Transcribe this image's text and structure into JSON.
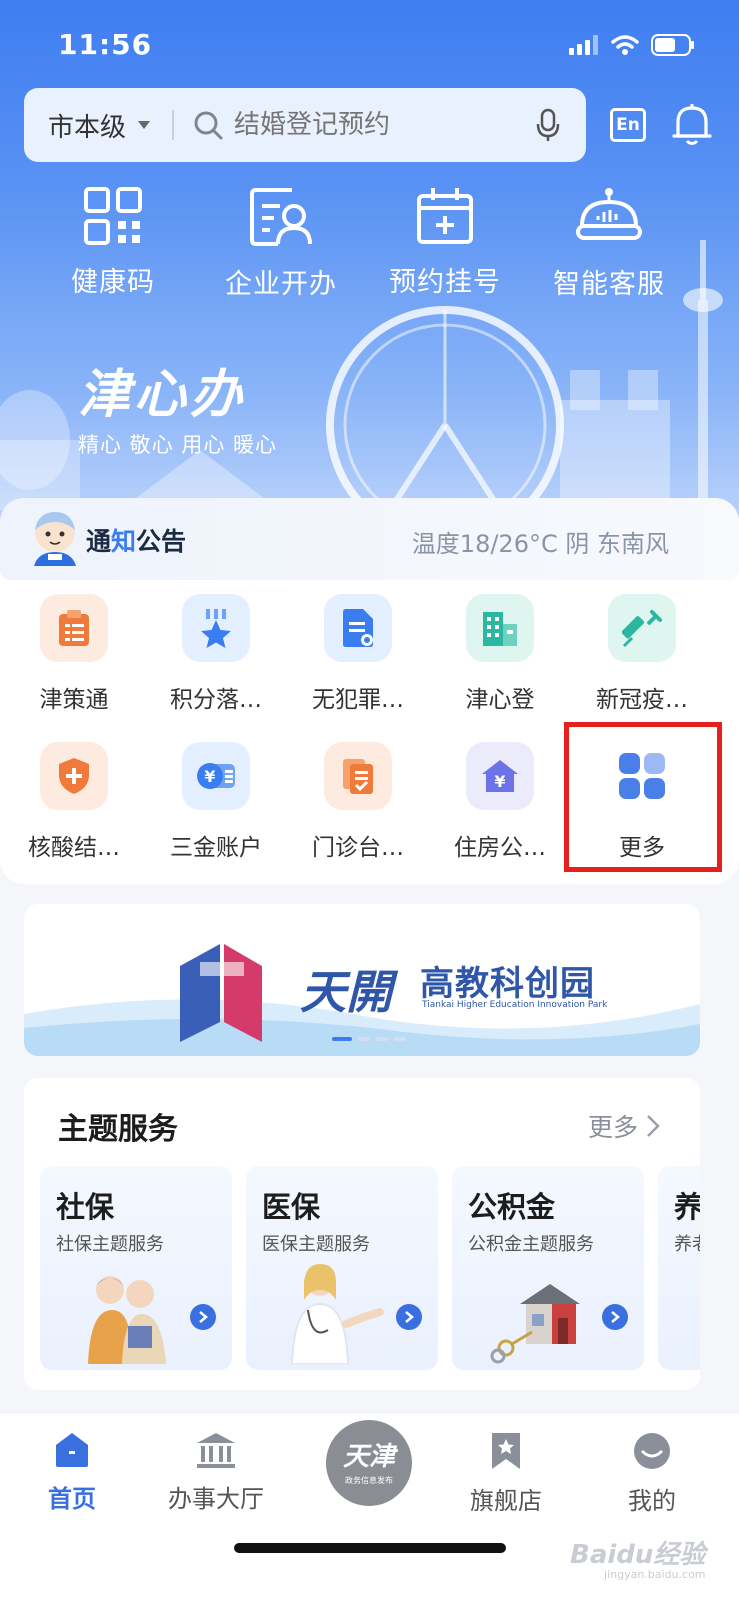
{
  "status_bar": {
    "time": "11:56"
  },
  "search": {
    "city": "市本级",
    "placeholder": "结婚登记预约"
  },
  "header": {
    "lang_button": "En"
  },
  "quick_actions": [
    {
      "label": "健康码",
      "icon": "qr-code-icon"
    },
    {
      "label": "企业开办",
      "icon": "business-card-icon"
    },
    {
      "label": "预约挂号",
      "icon": "calendar-plus-icon"
    },
    {
      "label": "智能客服",
      "icon": "robot-icon"
    }
  ],
  "slogan": {
    "title": "津心办",
    "subtitle": "精心 敬心 用心 暖心"
  },
  "notice": {
    "title_part1": "通",
    "title_part2": "知",
    "title_part3": "公告",
    "weather": "温度18/26°C 阴 东南风"
  },
  "services": [
    {
      "label": "津策通",
      "icon": "clipboard-icon",
      "color": "#f07a3a"
    },
    {
      "label": "积分落…",
      "icon": "star-badge-icon",
      "color": "#3a7df0"
    },
    {
      "label": "无犯罪…",
      "icon": "document-icon",
      "color": "#3a7df0"
    },
    {
      "label": "津心登",
      "icon": "building-icon",
      "color": "#2bb7a1"
    },
    {
      "label": "新冠疫…",
      "icon": "syringe-icon",
      "color": "#2bb7a1"
    },
    {
      "label": "核酸结…",
      "icon": "shield-plus-icon",
      "color": "#f07a3a"
    },
    {
      "label": "三金账户",
      "icon": "yuan-card-icon",
      "color": "#3a7df0"
    },
    {
      "label": "门诊台…",
      "icon": "records-icon",
      "color": "#f07a3a"
    },
    {
      "label": "住房公…",
      "icon": "house-yuan-icon",
      "color": "#6b73e6"
    },
    {
      "label": "更多",
      "icon": "grid-more-icon",
      "color": "#3a6fe0"
    }
  ],
  "banner": {
    "brand": "天開",
    "title": "高教科创园",
    "subtitle": "Tiankai Higher Education Innovation Park"
  },
  "theme_services": {
    "title": "主题服务",
    "more": "更多",
    "cards": [
      {
        "name": "社保",
        "desc": "社保主题服务"
      },
      {
        "name": "医保",
        "desc": "医保主题服务"
      },
      {
        "name": "公积金",
        "desc": "公积金主题服务"
      },
      {
        "name": "养",
        "desc": "养老"
      }
    ]
  },
  "tabbar": {
    "tabs": [
      {
        "label": "首页"
      },
      {
        "label": "办事大厅"
      },
      {
        "label": "旗舰店"
      },
      {
        "label": "我的"
      }
    ],
    "center_title": "天津",
    "center_sub": "政务信息发布"
  },
  "watermark": {
    "main": "Baidu经验",
    "sub": "jingyan.baidu.com"
  }
}
